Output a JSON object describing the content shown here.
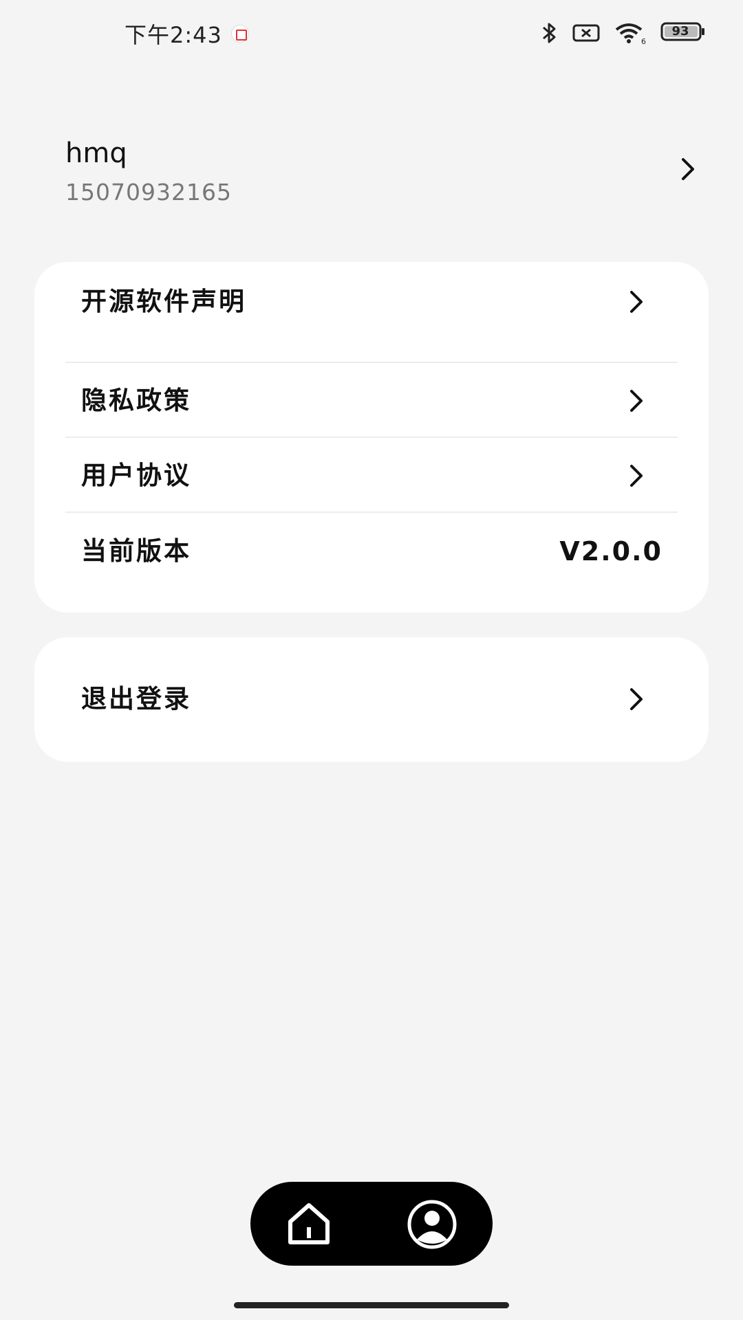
{
  "status_bar": {
    "time": "下午2:43",
    "battery": "93"
  },
  "profile": {
    "name": "hmq",
    "phone": "15070932165"
  },
  "settings": {
    "open_source_label": "开源软件声明",
    "privacy_label": "隐私政策",
    "agreement_label": "用户协议",
    "version_label": "当前版本",
    "version_value": "V2.0.0"
  },
  "logout": {
    "label": "退出登录"
  },
  "nav": {
    "home_icon": "home-icon",
    "profile_icon": "user-circle-icon"
  }
}
